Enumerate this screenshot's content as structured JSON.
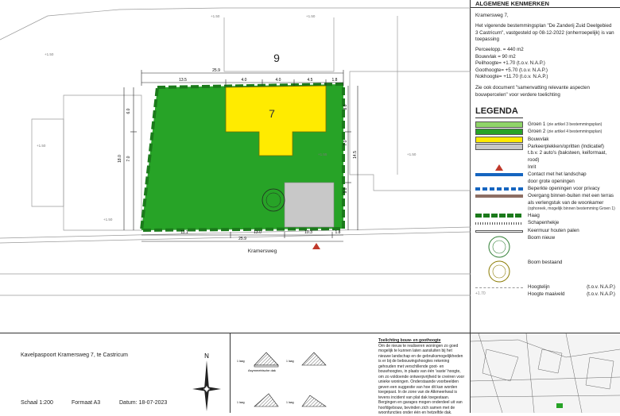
{
  "plan": {
    "lot_number_big": "9",
    "lot_number": "7",
    "street_name": "Kramersweg",
    "dims": {
      "top_a": "25.9",
      "top_b": "13.5",
      "top_c": "4.0",
      "top_d": "4.0",
      "top_e": "4.5",
      "top_f": "1.8",
      "left_a": "6.0",
      "left_b": "7.0",
      "left_c": "18.0",
      "right_a": "8.0",
      "right_b": "14.5",
      "right_c": "7.0",
      "right_d": "9.0",
      "bot_a": "11.1",
      "bot_b": "13.0",
      "bot_c": "10.3",
      "bot_d": "1.8",
      "bot_total": "25.9"
    },
    "heights": [
      "+1.50",
      "+1.50",
      "+1.50",
      "+1.50",
      "+1.50",
      "+1.55",
      "+1.50"
    ]
  },
  "side": {
    "header": "ALGEMENE KENMERKEN",
    "address": "Kramersweg 7,",
    "plan_text": "Het vigerende bestemmingsplan \"De Zanderij Zuid Deelgebied 3 Castricum\", vastgesteld op 08-12-2022 (onherroepelijk) is van toepassing",
    "kenmerken": [
      "Perceelopp. = 440 m2",
      "Bouwvlak = 90 m2",
      "Peilhoogte= +1.70 (t.o.v. N.A.P.)",
      "Goothoogte= +5.70 (t.o.v. N.A.P.)",
      "Nokhoogte= +11.70 (t.o.v. N.A.P.)"
    ],
    "see_doc": "Zie ook document \"samenvatting relevante aspecten bouwpercelen\" voor verdere toelichting",
    "legend_title": "LEGENDA",
    "legend": [
      {
        "label": "Groen 1",
        "note": "(zie artikel 3 bestemmingsplan)"
      },
      {
        "label": "Groen 2",
        "note": "(zie artikel 4 bestemmingsplan)"
      },
      {
        "label": "Bouwvlak",
        "note": ""
      },
      {
        "label": "Parkeerplekken/opritten (Indicatief)",
        "note": "t.b.v. 2 auto's (baksteen, keiformaat, rood)"
      },
      {
        "label": "Inrit",
        "note": ""
      },
      {
        "label": "Contact met het landschap",
        "note": "door grote openingen"
      },
      {
        "label": "Beperkte openingen voor privacy",
        "note": ""
      },
      {
        "label": "Overgang binnen-buiten met een terras",
        "note": "als verlengstuk van de woonkamer"
      },
      {
        "label": "Haag",
        "note": ""
      },
      {
        "label": "Schapenhekje",
        "note": ""
      },
      {
        "label": "Keermuur houten palen",
        "note": ""
      },
      {
        "label": "Boom nieuw",
        "note": ""
      },
      {
        "label": "Boom bestaand",
        "note": ""
      },
      {
        "label": "Hoogtelijn",
        "note": "(t.o.v. N.A.P.)"
      },
      {
        "label": "Hoogte maaiveld",
        "note": "(t.o.v. N.A.P.)"
      }
    ],
    "legend_sub": "(ophoreek, mogelijk binnen bestemming Groen 1)",
    "maaiveld_value": "+1.70"
  },
  "title_block": {
    "title": "Kavelpaspoort Kramersweg 7, te Castricum",
    "schaal": "Schaal 1:200",
    "formaat": "Formaat A3",
    "datum": "Datum: 18-07-2023",
    "north": "N"
  },
  "diagrams": {
    "heading": "Toelichting bouw- en goothoogte",
    "asym": "Asymmetrische dak",
    "text": "Om de nieuw te realiseren woningen zo goed mogelijk te kunnen laten aansluiten bij het nieuwe landschap en de gebruiksmogelijkheden is er bij de bebouwingshoogtes rekening gehouden met verschillende goot- en bouwhoogtes, in plaats van één 'vaste' hoogte, om zo voldoende ontwerpvrijheid te creëren voor unieke woningen. Onderstaande voorbeelden geven een suggestie van hoe dit kan worden toegepast. In de zone van de Alkmeerkwal is tevens incident van plat dak toegestaan. Bergingen en garages mogen onderdeel uit van hoofdgebouw, bevinden zich samen met de woonfuncties onder één en hetzelfde dak.",
    "labels": [
      "1 laag",
      "1 laag",
      "1 laag",
      "1 laag"
    ]
  },
  "colors": {
    "groen1": "#8fd468",
    "groen2": "#27a327",
    "bouwvlak": "#ffeb00",
    "parking": "#c8c8c8",
    "inrit": "#c0392b",
    "contact": "#1565c0",
    "terras": "#8d6e63"
  }
}
